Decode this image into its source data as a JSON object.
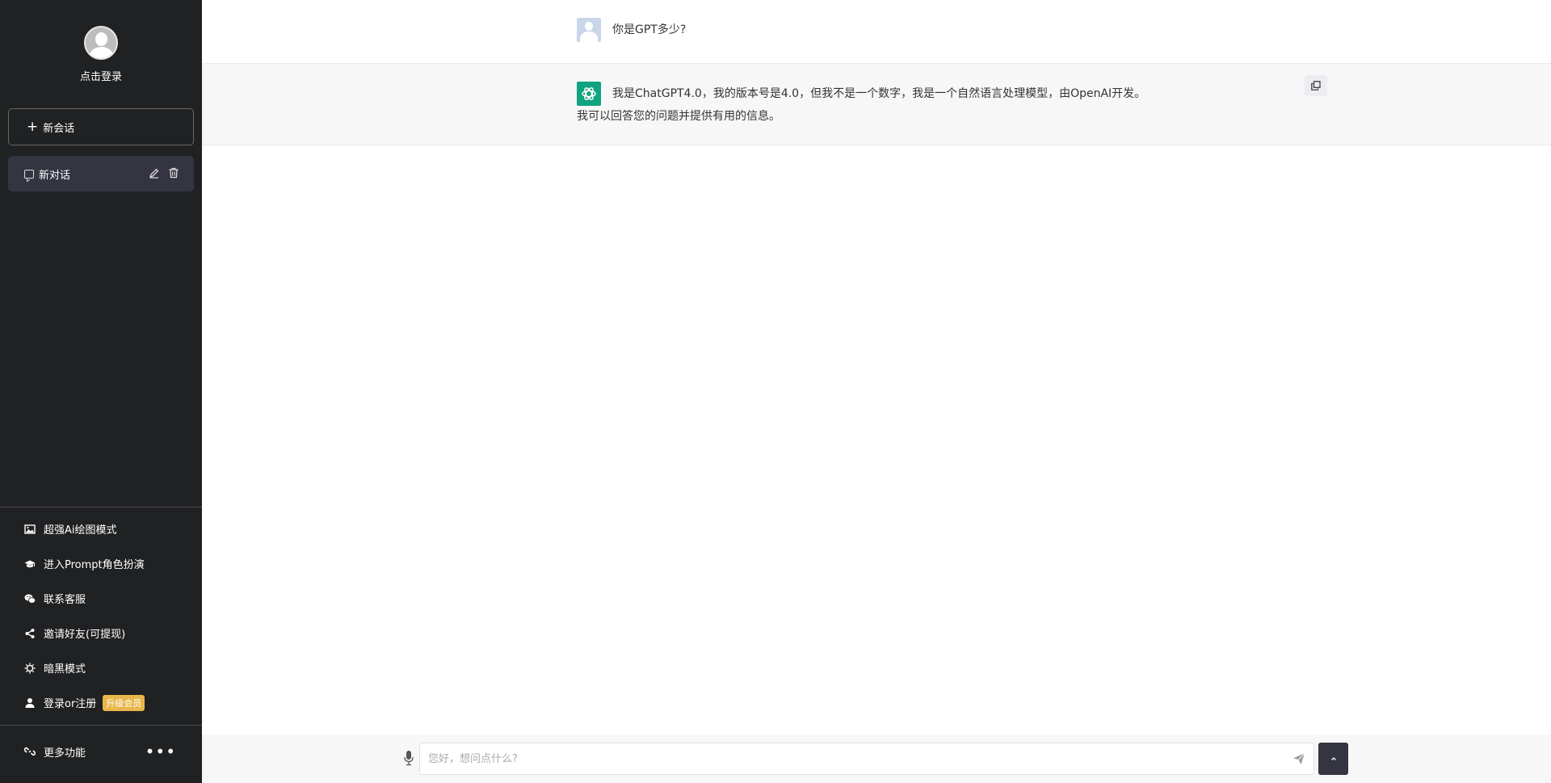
{
  "sidebar": {
    "login_label": "点击登录",
    "new_chat_label": "新会话",
    "conversations": [
      {
        "title": "新对话"
      }
    ],
    "menu": [
      {
        "label": "超强Ai绘图模式",
        "icon": "image-icon"
      },
      {
        "label": "进入Prompt角色扮演",
        "icon": "graduation-cap-icon"
      },
      {
        "label": "联系客服",
        "icon": "wechat-icon"
      },
      {
        "label": "邀请好友(可提现)",
        "icon": "share-icon"
      },
      {
        "label": "暗黑模式",
        "icon": "sun-icon"
      },
      {
        "label": "登录or注册",
        "icon": "user-icon",
        "badge": "升级会员"
      }
    ],
    "more_label": "更多功能",
    "more_dots": "•••"
  },
  "messages": [
    {
      "role": "user",
      "text": "你是GPT多少?"
    },
    {
      "role": "assistant",
      "line1": "我是ChatGPT4.0，我的版本号是4.0，但我不是一个数字，我是一个自然语言处理模型，由OpenAI开发。",
      "line2": "我可以回答您的问题并提供有用的信息。"
    }
  ],
  "input": {
    "placeholder": "您好，想问点什么?"
  },
  "colors": {
    "sidebar_bg": "#202123",
    "accent_green": "#10a37f",
    "badge": "#e8b64a"
  }
}
